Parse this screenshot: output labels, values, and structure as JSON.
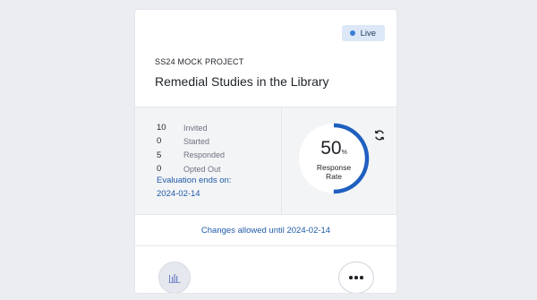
{
  "card": {
    "status": {
      "label": "Live",
      "color": "#3a7bd5"
    },
    "project": {
      "code": "SS24 MOCK PROJECT",
      "title": "Remedial Studies in the Library"
    },
    "stats": [
      {
        "value": "10",
        "label": "Invited"
      },
      {
        "value": "0",
        "label": "Started"
      },
      {
        "value": "5",
        "label": "Responded"
      },
      {
        "value": "0",
        "label": "Opted Out"
      }
    ],
    "evaluation": {
      "label": "Evaluation ends on:",
      "date": "2024-02-14"
    },
    "response_rate": {
      "value": "50",
      "unit": "%",
      "caption_line1": "Response",
      "caption_line2": "Rate",
      "fraction": 0.5,
      "ring_color": "#1f5fc0"
    },
    "changes_text": "Changes allowed until 2024-02-14",
    "icons": {
      "refresh": "refresh-icon",
      "report": "bar-chart-icon",
      "more": "more-icon"
    }
  }
}
